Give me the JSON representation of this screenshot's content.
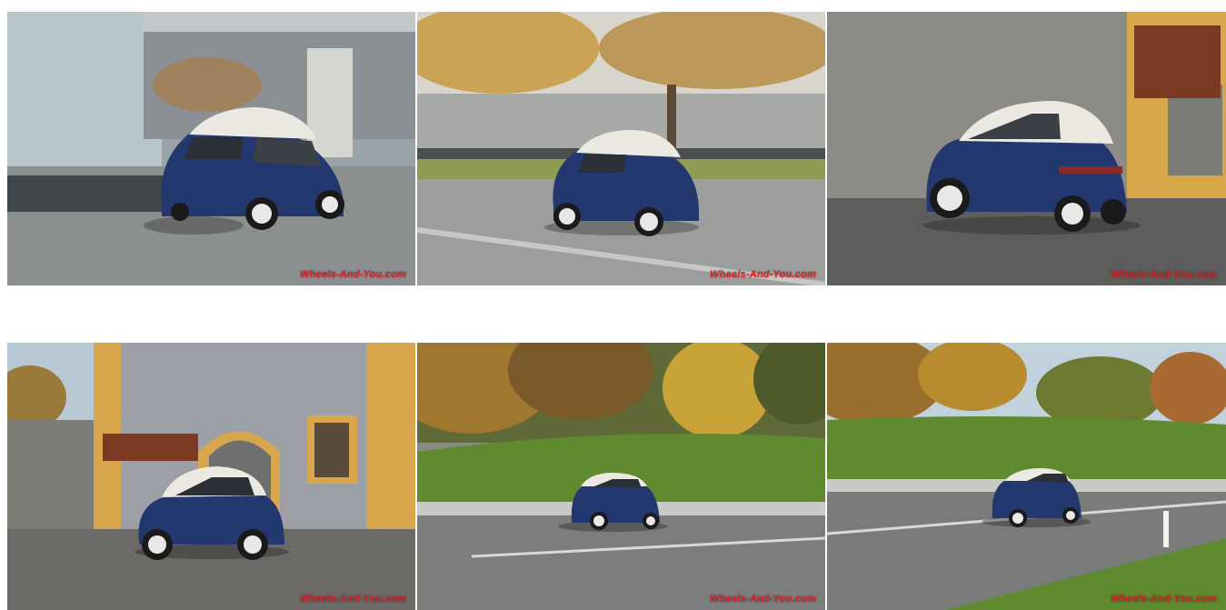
{
  "gallery": {
    "photos": [
      {
        "id": "photo-1",
        "scene": "glass-office-street",
        "watermark": "Wheels-And-You.com"
      },
      {
        "id": "photo-2",
        "scene": "autumn-tree-building",
        "watermark": "Wheels-And-You.com"
      },
      {
        "id": "photo-3",
        "scene": "stone-wall-signpost",
        "watermark": "Wheels-And-You.com"
      },
      {
        "id": "photo-4",
        "scene": "yellow-building-cobblestone",
        "watermark": "Wheels-And-You.com"
      },
      {
        "id": "photo-5",
        "scene": "road-grass-autumn-trees",
        "watermark": "Wheels-And-You.com"
      },
      {
        "id": "photo-6",
        "scene": "road-grass-autumn-trees-wide",
        "watermark": "Wheels-And-You.com"
      }
    ]
  },
  "colors": {
    "car_body": "#23386e",
    "car_roof": "#ece9e2",
    "watermark_red": "#e0202a"
  }
}
